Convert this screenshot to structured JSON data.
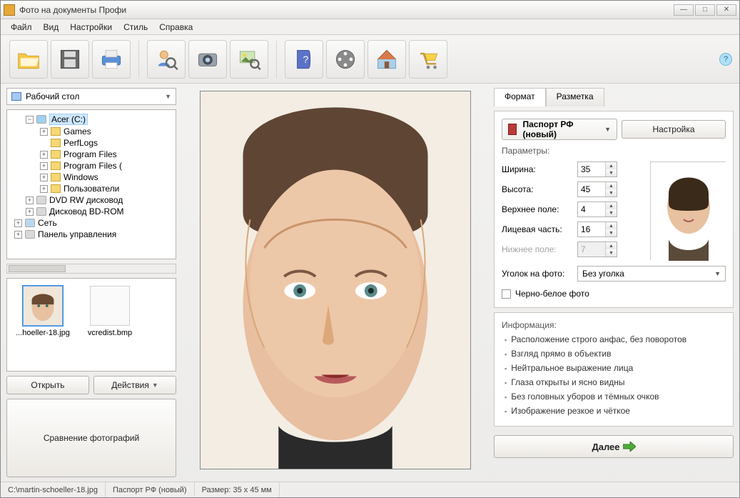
{
  "title": "Фото на документы Профи",
  "menu": {
    "file": "Файл",
    "view": "Вид",
    "settings": "Настройки",
    "style": "Стиль",
    "help": "Справка"
  },
  "toolbar": {
    "icons": [
      "open-folder-icon",
      "save-icon",
      "print-icon",
      "search-user-icon",
      "camera-icon",
      "picture-search-icon",
      "help-book-icon",
      "film-reel-icon",
      "home-icon",
      "cart-icon"
    ]
  },
  "left": {
    "location": "Рабочий стол",
    "tree": {
      "acer": "Acer (C:)",
      "games": "Games",
      "perflogs": "PerfLogs",
      "pf": "Program Files",
      "pf2": "Program Files (",
      "windows": "Windows",
      "users": "Пользователи",
      "dvd": "DVD RW дисковод",
      "bd": "Дисковод BD-ROM",
      "net": "Сеть",
      "cp": "Панель управления"
    },
    "thumbs": {
      "file1": "...hoeller-18.jpg",
      "file2": "vcredist.bmp"
    },
    "open": "Открыть",
    "actions": "Действия",
    "compare": "Сравнение фотографий"
  },
  "tabs": {
    "format": "Формат",
    "layout": "Разметка"
  },
  "format": {
    "selected": "Паспорт РФ (новый)",
    "settings_btn": "Настройка",
    "params_label": "Параметры:",
    "width_label": "Ширина:",
    "width": "35",
    "height_label": "Высота:",
    "height": "45",
    "top_label": "Верхнее поле:",
    "top": "4",
    "face_label": "Лицевая часть:",
    "face": "16",
    "bottom_label": "Нижнее поле:",
    "bottom": "7",
    "corner_label": "Уголок на фото:",
    "corner_value": "Без уголка",
    "bw_label": "Черно-белое фото"
  },
  "info": {
    "label": "Информация:",
    "i1": "Расположение строго анфас, без поворотов",
    "i2": "Взгляд прямо в объектив",
    "i3": "Нейтральное выражение лица",
    "i4": "Глаза открыты и ясно видны",
    "i5": "Без головных уборов и тёмных очков",
    "i6": "Изображение резкое и чёткое"
  },
  "next": "Далее",
  "status": {
    "path": "C:\\martin-schoeller-18.jpg",
    "format": "Паспорт РФ (новый)",
    "size": "Размер: 35 x 45 мм"
  }
}
